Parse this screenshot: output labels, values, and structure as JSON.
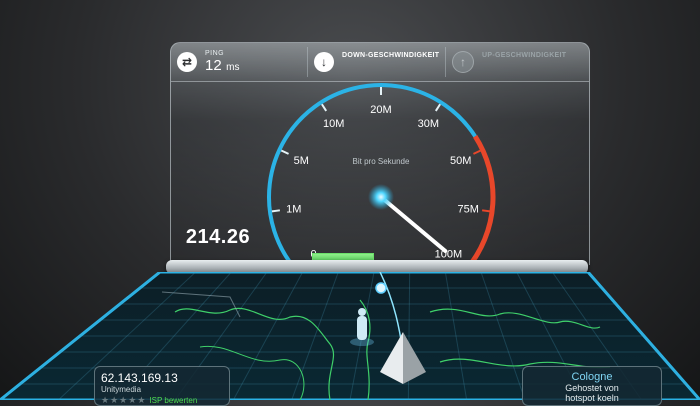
{
  "header": {
    "ping": {
      "label": "PING",
      "value": "12",
      "unit": "ms"
    },
    "download": {
      "label": "DOWN-GESCHWINDIGKEIT"
    },
    "upload": {
      "label": "UP-GESCHWINDIGKEIT"
    }
  },
  "gauge": {
    "caption": "Bit pro Sekunde",
    "tick_labels": [
      "0",
      "1M",
      "5M",
      "10M",
      "20M",
      "30M",
      "50M",
      "75M",
      "100M"
    ],
    "current_value": "214.26",
    "needle_fraction": 1.0
  },
  "progress": {
    "fraction": 0.2
  },
  "server_info": {
    "ip": "62.143.169.13",
    "isp": "Unitymedia",
    "rate_label": "ISP bewerten",
    "stars": 5
  },
  "host": {
    "city": "Cologne",
    "hosted_by_line1": "Gehostet von",
    "hosted_by_line2": "hotspot koeln"
  },
  "colors": {
    "accent_green": "#4fdc4f",
    "gauge_blue": "#2bb3e6",
    "gauge_red": "#e8472a"
  }
}
